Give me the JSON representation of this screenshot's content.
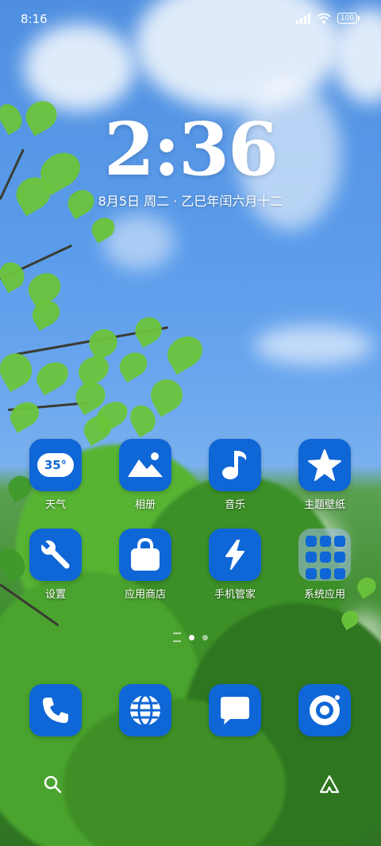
{
  "status_bar": {
    "time": "8:16",
    "battery": "100"
  },
  "lockscreen": {
    "clock": "2:36",
    "date": "8月5日 周二 · 乙巳年闰六月十二"
  },
  "weather_widget": {
    "temperature": "35°"
  },
  "apps": [
    {
      "label": "天气",
      "icon": "weather-icon"
    },
    {
      "label": "相册",
      "icon": "gallery-icon"
    },
    {
      "label": "音乐",
      "icon": "music-icon"
    },
    {
      "label": "主题壁纸",
      "icon": "theme-star-icon"
    },
    {
      "label": "设置",
      "icon": "wrench-icon"
    },
    {
      "label": "应用商店",
      "icon": "shopping-bag-icon"
    },
    {
      "label": "手机管家",
      "icon": "lightning-icon"
    },
    {
      "label": "系统应用",
      "icon": "folder-icon"
    }
  ],
  "dock": [
    {
      "icon": "phone-icon"
    },
    {
      "icon": "globe-icon"
    },
    {
      "icon": "message-icon"
    },
    {
      "icon": "camera-icon"
    }
  ],
  "pager": {
    "pages": 2,
    "current": 1
  },
  "colors": {
    "icon_bg": "#0f66d6",
    "sky": "#5b9cea",
    "foliage": "#3d8a2c"
  }
}
